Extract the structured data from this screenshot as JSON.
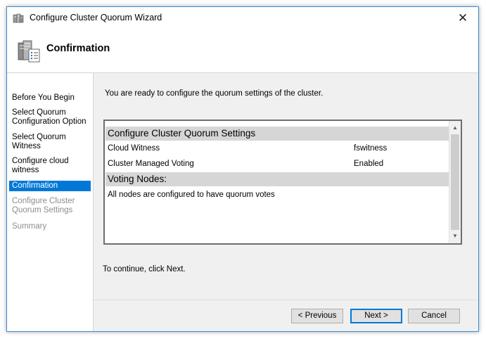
{
  "window": {
    "title": "Configure Cluster Quorum Wizard",
    "close_glyph": "✕"
  },
  "header": {
    "title": "Confirmation",
    "icon": "cluster-server-icon"
  },
  "nav": {
    "items": [
      {
        "label": "Before You Begin",
        "state": "normal"
      },
      {
        "label": "Select Quorum Configuration Option",
        "state": "normal"
      },
      {
        "label": "Select Quorum Witness",
        "state": "normal"
      },
      {
        "label": "Configure cloud witness",
        "state": "normal"
      },
      {
        "label": "Confirmation",
        "state": "active"
      },
      {
        "label": "Configure Cluster Quorum Settings",
        "state": "disabled"
      },
      {
        "label": "Summary",
        "state": "disabled"
      }
    ]
  },
  "content": {
    "intro": "You are ready to configure the quorum settings of the cluster.",
    "report": {
      "settings_heading": "Configure Cluster Quorum Settings",
      "rows": [
        {
          "label": "Cloud Witness",
          "value": "fswitness"
        },
        {
          "label": "Cluster Managed Voting",
          "value": "Enabled"
        }
      ],
      "voting_heading": "Voting Nodes:",
      "voting_text": "All nodes are configured to have quorum votes"
    },
    "continue_text": "To continue, click Next."
  },
  "buttons": {
    "previous": "< Previous",
    "next": "Next >",
    "cancel": "Cancel"
  },
  "colors": {
    "accent": "#0078d7",
    "section_bg": "#d6d6d6",
    "dialog_bg": "#f0f0f0"
  }
}
